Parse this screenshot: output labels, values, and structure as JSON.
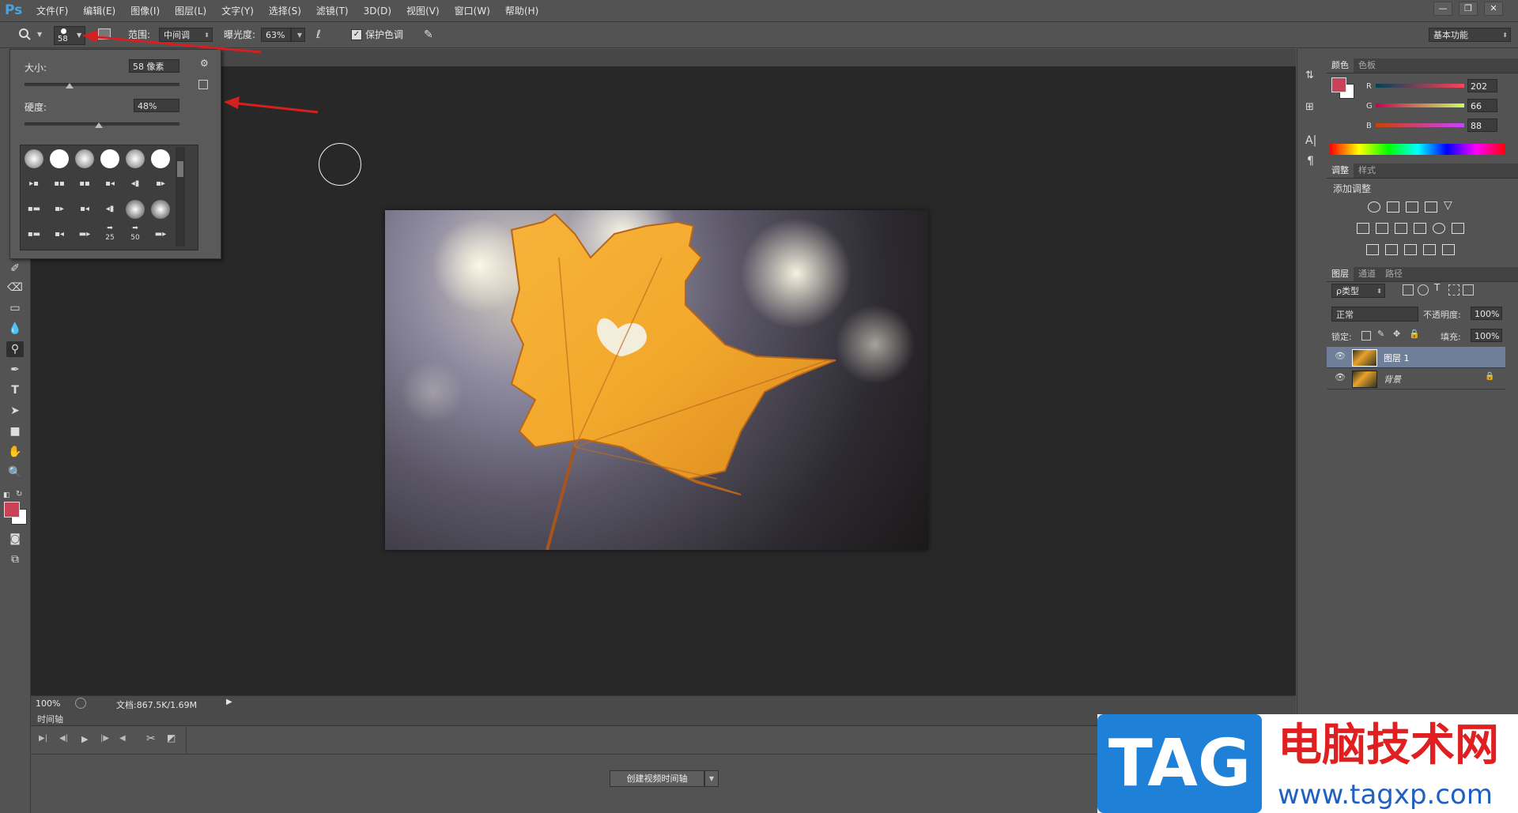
{
  "app": {
    "logo": "Ps"
  },
  "menu": [
    "文件(F)",
    "编辑(E)",
    "图像(I)",
    "图层(L)",
    "文字(Y)",
    "选择(S)",
    "滤镜(T)",
    "3D(D)",
    "视图(V)",
    "窗口(W)",
    "帮助(H)"
  ],
  "window_controls": {
    "minimize": "—",
    "restore": "❐",
    "close": "✕"
  },
  "options_bar": {
    "brush_size_value": "58",
    "range_label": "范围:",
    "range_value": "中间调",
    "exposure_label": "曝光度:",
    "exposure_value": "63%",
    "protect_tones_label": "保护色调",
    "protect_tones_checked": true,
    "workspace_value": "基本功能"
  },
  "brush_picker": {
    "size_label": "大小:",
    "size_value": "58 像素",
    "size_fraction": 0.29,
    "hardness_label": "硬度:",
    "hardness_value": "48%",
    "hardness_fraction": 0.48,
    "preset_labels": [
      "25",
      "50"
    ]
  },
  "status_bar": {
    "zoom": "100%",
    "doc_info": "文档:867.5K/1.69M"
  },
  "timeline": {
    "title": "时间轴",
    "create_button": "创建视频时间轴"
  },
  "color_panel": {
    "tabs": [
      "颜色",
      "色板"
    ],
    "channels": [
      {
        "name": "R",
        "value": "202"
      },
      {
        "name": "G",
        "value": "66"
      },
      {
        "name": "B",
        "value": "88"
      }
    ],
    "foreground": "#ca4258",
    "background": "#ffffff"
  },
  "adjustments_panel": {
    "tabs": [
      "调整",
      "样式"
    ],
    "add_label": "添加调整"
  },
  "layers_panel": {
    "tabs": [
      "图层",
      "通道",
      "路径"
    ],
    "filter_label": "ρ类型",
    "blend_mode": "正常",
    "opacity_label": "不透明度:",
    "opacity_value": "100%",
    "lock_label": "锁定:",
    "fill_label": "填充:",
    "fill_value": "100%",
    "layers": [
      {
        "name": "图层 1",
        "selected": true,
        "locked": false
      },
      {
        "name": "背景",
        "selected": false,
        "locked": true
      }
    ]
  },
  "watermark": {
    "tag": "TAG",
    "site_name": "电脑技术网",
    "url": "www.tagxp.com"
  },
  "colors": {
    "accent": "#ca4258",
    "ps_blue": "#4aa3df",
    "arrow_red": "#d42020"
  }
}
